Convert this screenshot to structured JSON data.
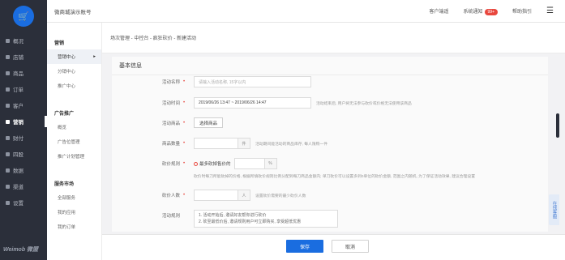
{
  "sidebar": {
    "items": [
      {
        "label": "概况"
      },
      {
        "label": "店铺"
      },
      {
        "label": "商品"
      },
      {
        "label": "订单"
      },
      {
        "label": "客户"
      },
      {
        "label": "营销"
      },
      {
        "label": "财付"
      },
      {
        "label": "四股"
      },
      {
        "label": "数据"
      },
      {
        "label": "渠道"
      },
      {
        "label": "设置"
      }
    ],
    "brand": "Weimob 微盟"
  },
  "header": {
    "store_name": "微商城演示账号",
    "customer_service": "客户端遥",
    "system_notice": "系统通知",
    "notice_badge": "99+",
    "help": "帮助指引"
  },
  "subnav": {
    "group1": "营销",
    "item_marketing_center": "营销中心",
    "item_distribution": "分销中心",
    "item_promotion": "推广中心",
    "group2": "广告推广",
    "item_overview": "概览",
    "item_ad_manage": "广告位管理",
    "item_ad_plan": "推广计划管理",
    "group3": "服务市场",
    "item_all_services": "全部服务",
    "item_my_apps": "我的应用",
    "item_my_orders": "我的订单"
  },
  "breadcrumb": "场次管理 - 中控台 - 疯狂砍价 - 新建活动",
  "form": {
    "section_title": "基本信息",
    "name_label": "活动名称",
    "name_placeholder": "请输入活动名称, 15字以内",
    "time_label": "活动时间",
    "time_value": "2019/06/26 13:47 ~ 2019/06/26 14:47",
    "time_hint": "活动结束后, 用户将无法参与砍价或价格无法使用该商品",
    "product_label": "活动商品",
    "product_button": "选择商品",
    "qty_label": "商品数量",
    "qty_unit": "件",
    "qty_hint": "活动期间能活动的商品库存, 每人限购一件",
    "bargain_label": "砍价规则",
    "bargain_option": "最多砍掉售价的",
    "bargain_unit": "%",
    "bargain_hint": "砍价时每刀所能砍掉的价格, 根据所填砍价规则比例分配到每刀商品金额内; 单刀砍价可以设置多到0单位的砍价金额, 范围之内随机, 为了保证活动效果, 建议合理设置",
    "people_label": "砍价人数",
    "people_unit": "人",
    "people_hint": "设置砍价需要的最少砍价人数",
    "rules_label": "活动规则",
    "rules_line1": "1. 活动开始后, 邀请好友帮你进行砍价",
    "rules_line2": "2. 砍至最低价后, 邀请规则用户可立即购买, 享受超低优惠"
  },
  "footer": {
    "save_label": "保存",
    "cancel_label": "取消"
  },
  "float_tab": "在线客服"
}
